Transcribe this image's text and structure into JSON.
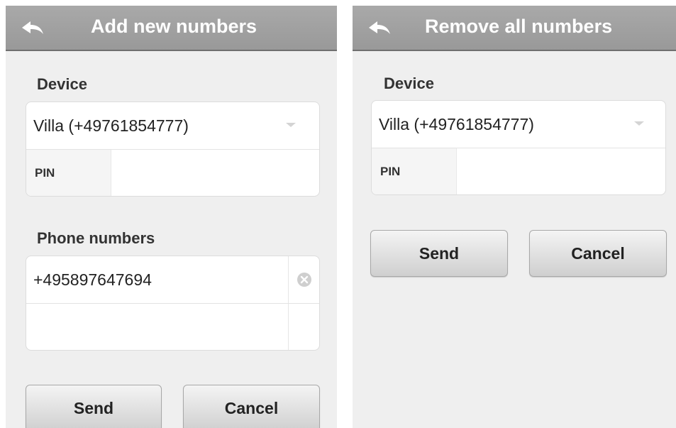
{
  "add_screen": {
    "title": "Add new numbers",
    "device_label": "Device",
    "device_value": "Villa (+49761854777)",
    "pin_label": "PIN",
    "pin_value": "",
    "phone_label": "Phone numbers",
    "phone_numbers": [
      "+495897647694",
      ""
    ],
    "send_label": "Send",
    "cancel_label": "Cancel"
  },
  "remove_screen": {
    "title": "Remove all numbers",
    "device_label": "Device",
    "device_value": "Villa (+49761854777)",
    "pin_label": "PIN",
    "pin_value": "",
    "send_label": "Send",
    "cancel_label": "Cancel"
  },
  "colors": {
    "topbar": "#a0a0a0",
    "background": "#efefef",
    "button_top": "#f4f4f4",
    "button_bottom": "#cfcfcf"
  },
  "icons": {
    "back": "back-arrow-icon",
    "dropdown": "chevron-down-icon",
    "clear": "clear-x-icon"
  }
}
